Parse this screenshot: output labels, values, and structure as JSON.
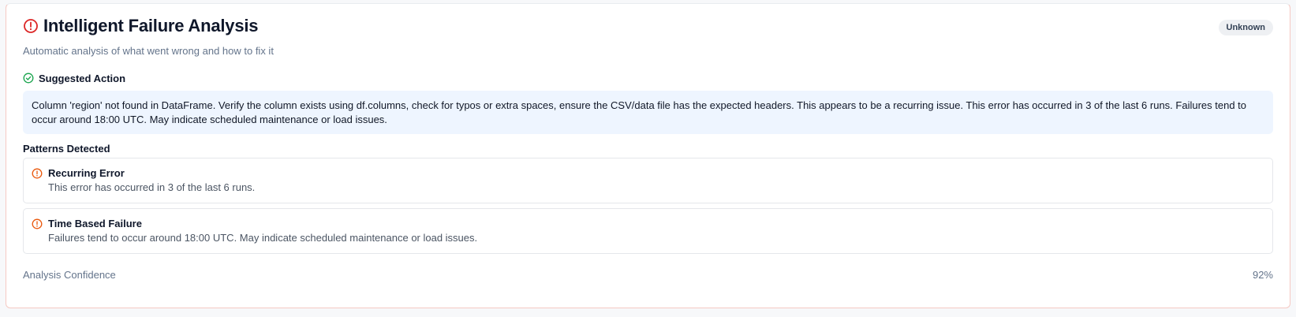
{
  "header": {
    "title": "Intelligent Failure Analysis",
    "subtitle": "Automatic analysis of what went wrong and how to fix it",
    "badge": "Unknown",
    "icon": "alert-circle-icon"
  },
  "suggested_action": {
    "label": "Suggested Action",
    "icon": "check-circle-icon",
    "text": "Column 'region' not found in DataFrame. Verify the column exists using df.columns, check for typos or extra spaces, ensure the CSV/data file has the expected headers. This appears to be a recurring issue. This error has occurred in 3 of the last 6 runs. Failures tend to occur around 18:00 UTC. May indicate scheduled maintenance or load issues."
  },
  "patterns": {
    "title": "Patterns Detected",
    "items": [
      {
        "title": "Recurring Error",
        "description": "This error has occurred in 3 of the last 6 runs.",
        "icon": "alert-circle-icon"
      },
      {
        "title": "Time Based Failure",
        "description": "Failures tend to occur around 18:00 UTC. May indicate scheduled maintenance or load issues.",
        "icon": "alert-circle-icon"
      }
    ]
  },
  "confidence": {
    "label": "Analysis Confidence",
    "value": "92%"
  },
  "colors": {
    "error_red": "#dc2626",
    "warning_orange": "#ea580c",
    "success_green": "#16a34a",
    "action_bg": "#eef5ff"
  }
}
